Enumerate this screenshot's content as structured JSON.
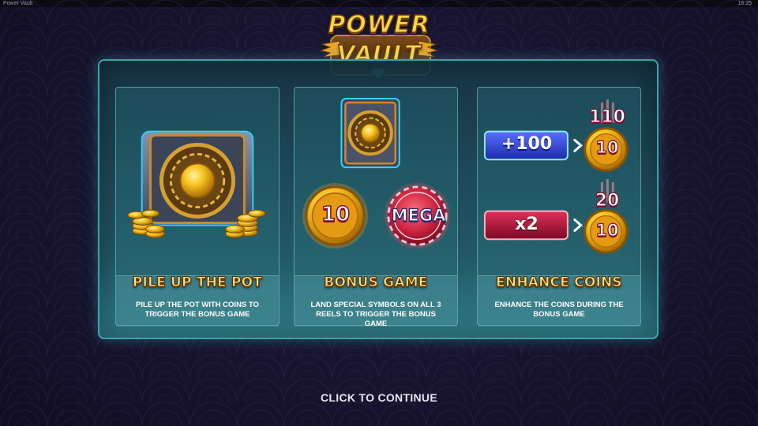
{
  "window": {
    "title": "Power Vault",
    "clock": "18:25"
  },
  "logo": {
    "line1": "POWER",
    "line2": "VAULT"
  },
  "cards": [
    {
      "title": "PILE UP THE POT",
      "description": "PILE UP THE POT WITH COINS TO TRIGGER THE BONUS GAME"
    },
    {
      "title": "BONUS GAME",
      "description": "LAND SPECIAL SYMBOLS ON ALL 3 REELS TO TRIGGER THE BONUS GAME",
      "coin_value": "10",
      "mega_label": "MEGA"
    },
    {
      "title": "ENHANCE COINS",
      "description": "ENHANCE THE COINS DURING THE BONUS GAME",
      "enhancements": [
        {
          "modifier": "+100",
          "coin_before": "10",
          "coin_after": "110"
        },
        {
          "modifier": "x2",
          "coin_before": "10",
          "coin_after": "20"
        }
      ]
    }
  ],
  "continue_label": "CLICK TO CONTINUE",
  "colors": {
    "panel_border": "#3aa3a8",
    "title_gold": "#ffe27a",
    "plus_badge": "#2b3fd6",
    "multiply_badge": "#b0163a",
    "mega_chip": "#c8203c",
    "coin_gold": "#f2b31c"
  }
}
